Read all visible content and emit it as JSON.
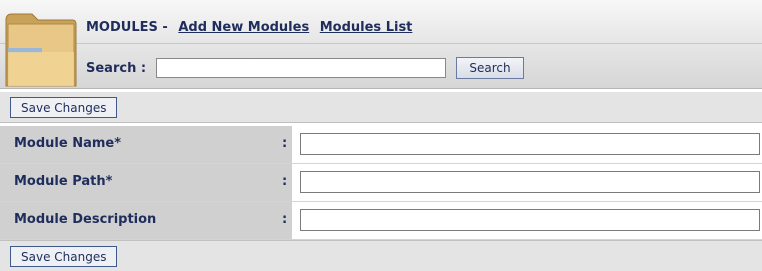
{
  "header": {
    "module_label": "MODULES -",
    "add_link": "Add New Modules",
    "list_link": "Modules List",
    "search_label": "Search :",
    "search_value": "",
    "search_button": "Search"
  },
  "actions": {
    "save_top": "Save Changes",
    "save_bottom": "Save Changes"
  },
  "form": {
    "rows": [
      {
        "label": "Module Name*",
        "colon": ":",
        "value": ""
      },
      {
        "label": "Module Path*",
        "colon": ":",
        "value": ""
      },
      {
        "label": "Module Description",
        "colon": ":",
        "value": ""
      }
    ]
  },
  "colors": {
    "text": "#1f2d5c",
    "label_bg": "#d0d0d0",
    "bar_bg": "#e4e4e4"
  },
  "icons": {
    "header_icon": "folder-icon"
  }
}
